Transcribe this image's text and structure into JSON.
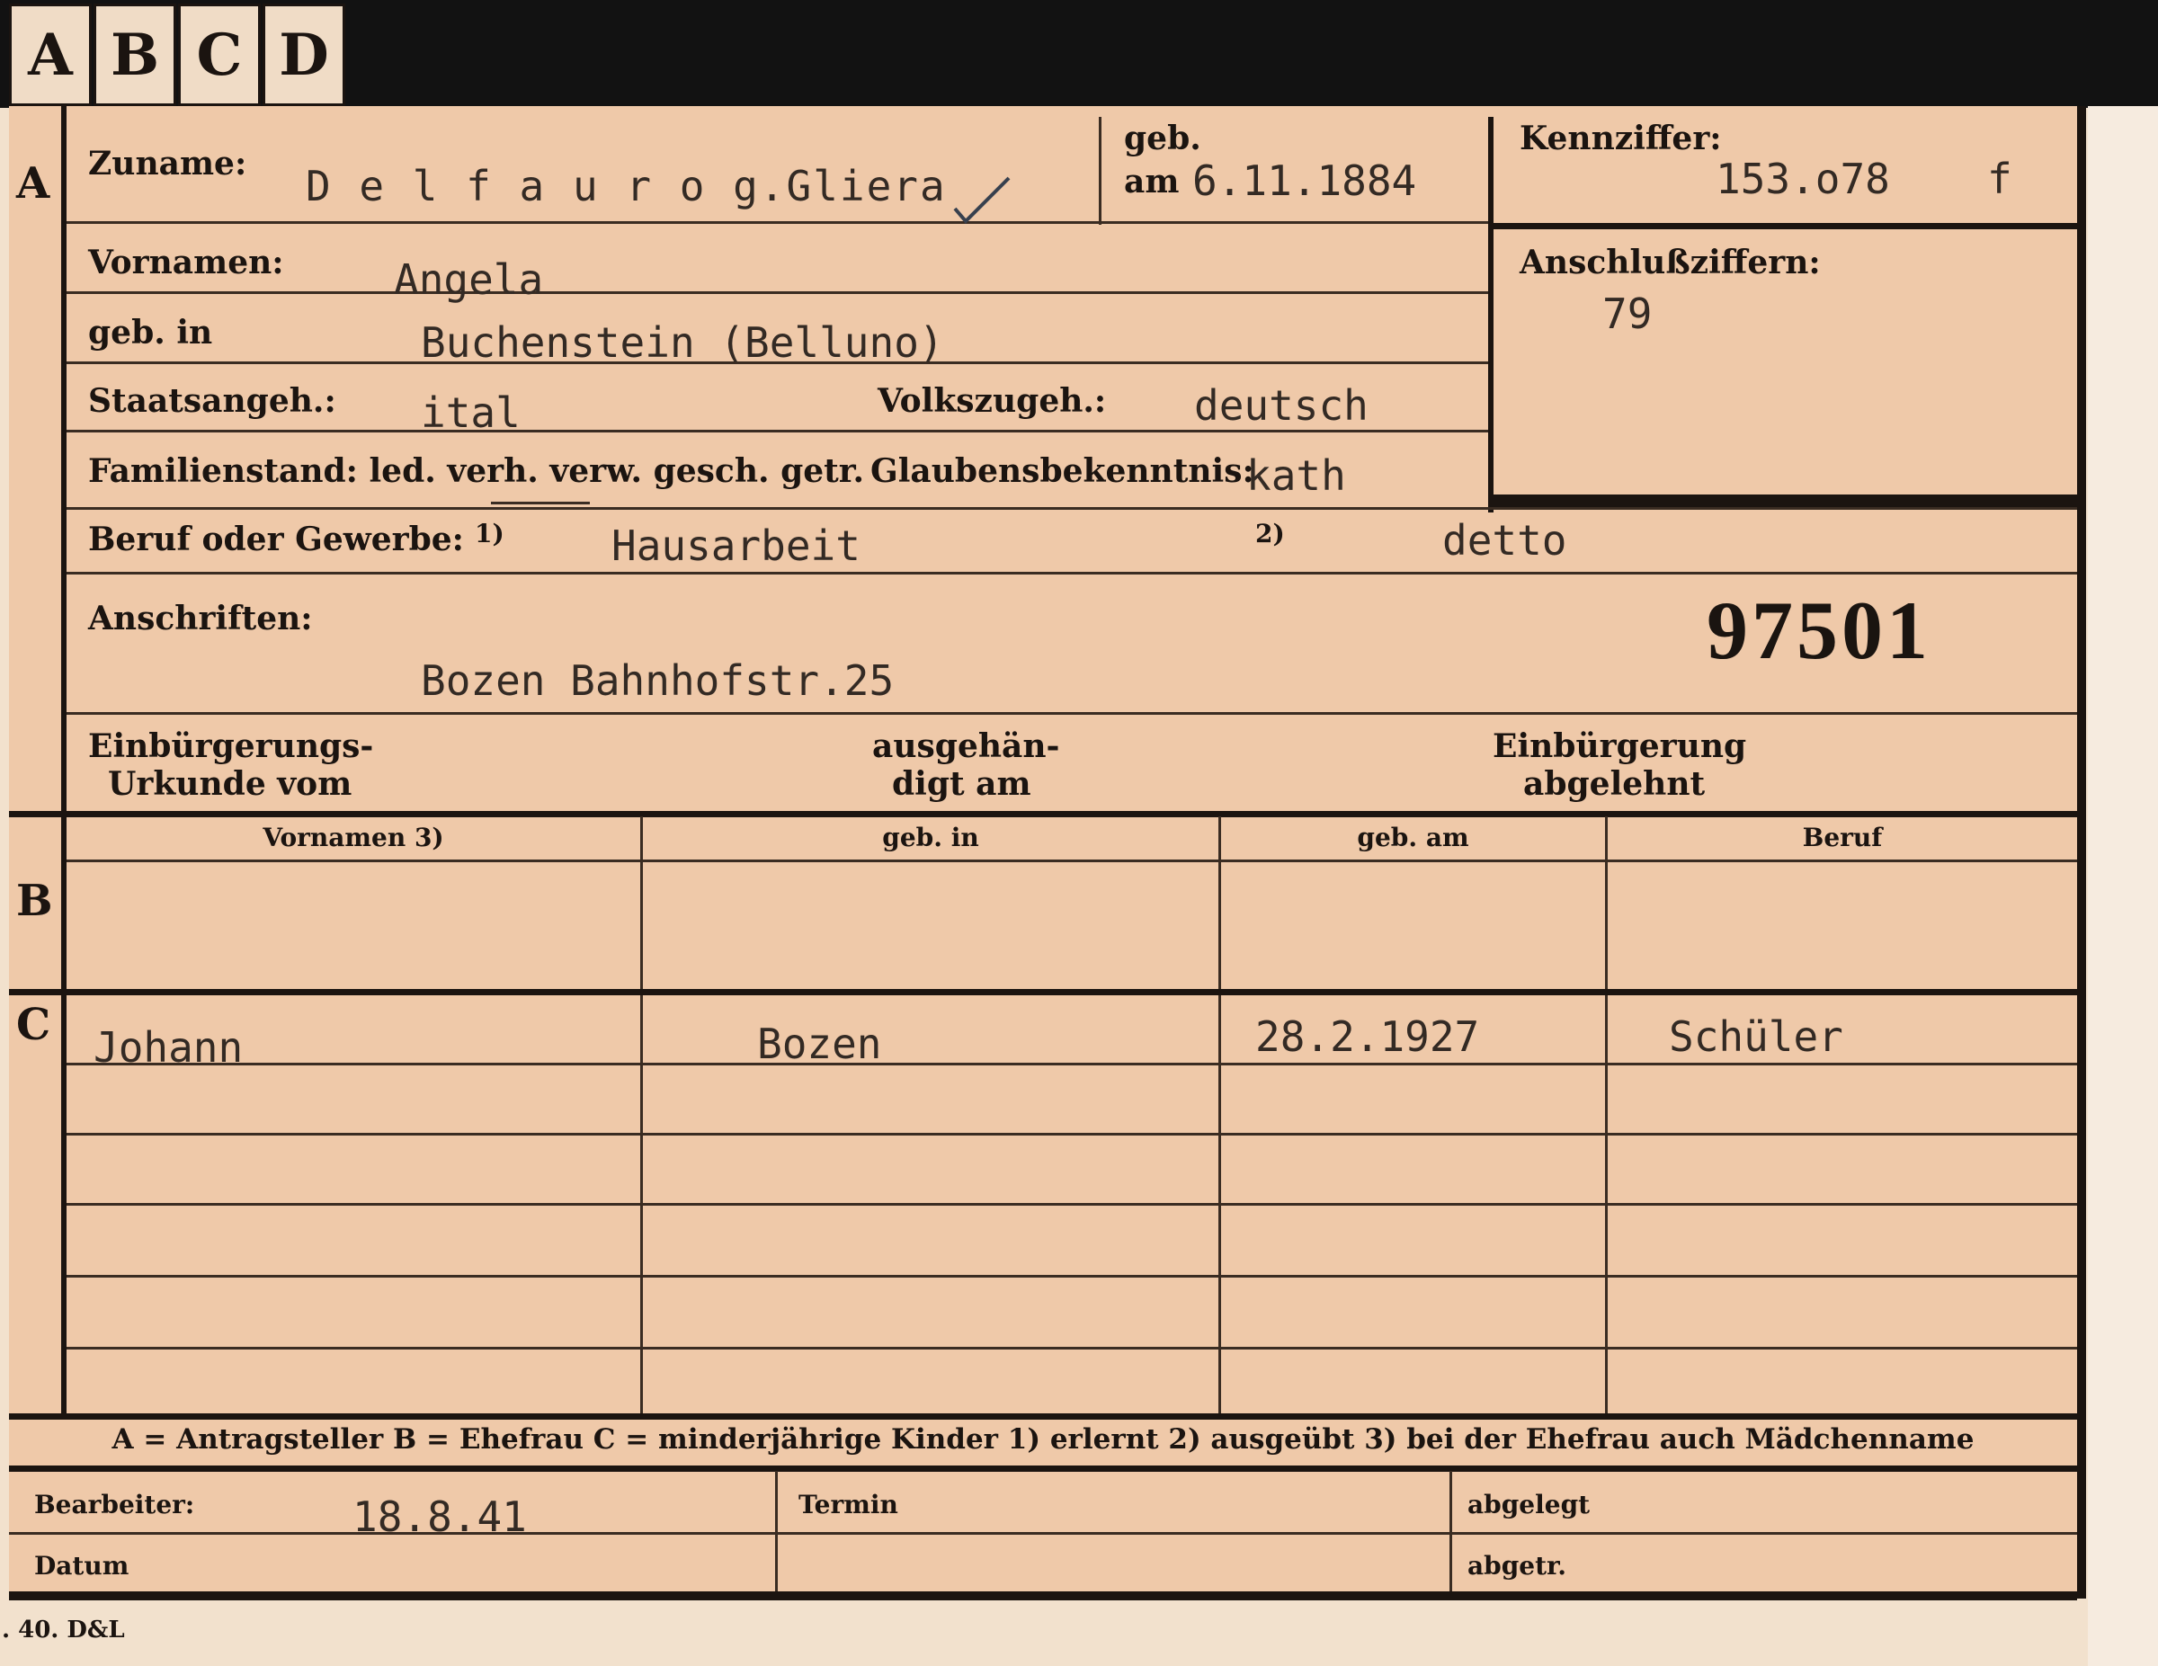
{
  "tabs": [
    "A",
    "B",
    "C",
    "D"
  ],
  "section_markers": {
    "a": "A",
    "b": "B",
    "c": "C"
  },
  "labels": {
    "zuname": "Zuname:",
    "geb": "geb.",
    "am": "am",
    "kennziffer": "Kennziffer:",
    "vornamen": "Vornamen:",
    "geb_in": "geb. in",
    "anschlussziffern": "Anschlußziffern:",
    "staatsangeh": "Staatsangeh.:",
    "volkszugeh": "Volkszugeh.:",
    "familienstand": "Familienstand: led. verh. verw. gesch. getr.",
    "glaubensbekenntnis": "Glaubensbekenntnis:",
    "beruf_oder_gewerbe": "Beruf oder Gewerbe:",
    "footnote_1": "1)",
    "footnote_2": "2)",
    "anschriften": "Anschriften:",
    "einbuergerungs_line1": "Einbürgerungs-",
    "einbuergerungs_line2": "Urkunde vom",
    "ausgehaendigt_line1": "ausgehän-",
    "ausgehaendigt_line2": "digt am",
    "einbuergerung_line1": "Einbürgerung",
    "einbuergerung_line2": "abgelehnt"
  },
  "values": {
    "zuname": "D e l f a u r o g.Gliera",
    "geb_am": "6.11.1884",
    "kennziffer": "153.o78",
    "kennziffer_suffix": "f",
    "vornamen": "Angela",
    "geb_in": "Buchenstein (Belluno)",
    "anschlussziffern": "79",
    "staatsangeh": "ital",
    "volkszugeh": "deutsch",
    "glaubensbekenntnis": "kath",
    "beruf_erlernt": "Hausarbeit",
    "beruf_ausgeuebt": "detto",
    "anschrift": "Bozen Bahnhofstr.25",
    "stamp_number": "97501"
  },
  "table": {
    "headers": [
      "Vornamen 3)",
      "geb. in",
      "geb. am",
      "Beruf"
    ],
    "children": [
      {
        "vornamen": "Johann",
        "geb_in": "Bozen",
        "geb_am": "28.2.1927",
        "beruf": "Schüler"
      }
    ]
  },
  "legend": "A = Antragsteller B = Ehefrau C = minderjährige Kinder 1) erlernt 2) ausgeübt 3) bei der Ehefrau auch Mädchenname",
  "footer": {
    "bearbeiter_label": "Bearbeiter:",
    "bearbeiter_value": "18.8.41",
    "datum_label": "Datum",
    "termin_label": "Termin",
    "abgelegt_label": "abgelegt",
    "abgetr_label": "abgetr.",
    "print_mark": ". 40. D&L"
  }
}
